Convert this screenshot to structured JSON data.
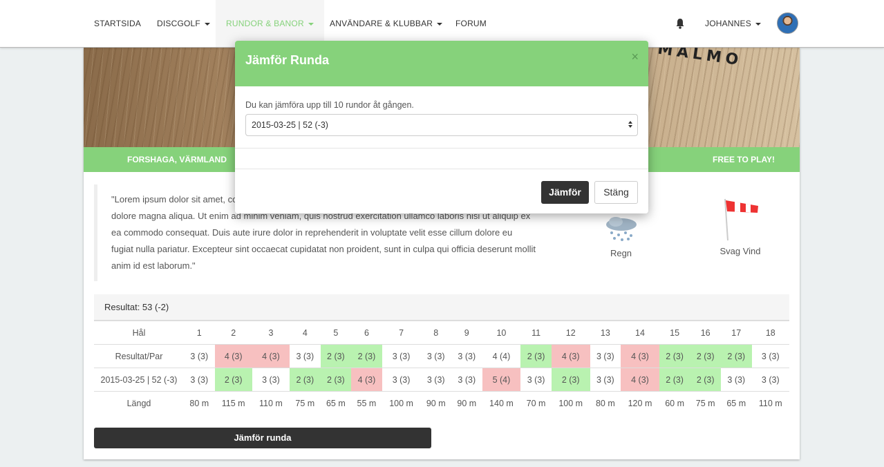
{
  "nav": {
    "items": [
      {
        "label": "STARTSIDA",
        "caret": false
      },
      {
        "label": "DISCGOLF",
        "caret": true
      },
      {
        "label": "RUNDOR & BANOR",
        "caret": true
      },
      {
        "label": "ANVÄNDARE & KLUBBAR",
        "caret": true
      },
      {
        "label": "FORUM",
        "caret": false
      }
    ],
    "user": "JOHANNES",
    "accent_color": "#86d27b"
  },
  "banner": {
    "text": "MALMO"
  },
  "info_bar": {
    "location": "FORSHAGA, VÄRMLAND",
    "price": "FREE TO PLAY!"
  },
  "description": "\"Lorem ipsum dolor sit amet, consectetur adipiscing elit, sed do eiusmod tempor incididunt ut labore et dolore magna aliqua. Ut enim ad minim veniam, quis nostrud exercitation ullamco laboris nisi ut aliquip ex ea commodo consequat. Duis aute irure dolor in reprehenderit in voluptate velit esse cillum dolore eu fugiat nulla pariatur. Excepteur sint occaecat cupidatat non proident, sunt in culpa qui officia deserunt mollit anim id est laborum.\"",
  "weather": {
    "rain": "Regn",
    "wind": "Svag Vind"
  },
  "result": {
    "summary": "Resultat: 53 (-2)",
    "header_label": "Hål",
    "holes": [
      "1",
      "2",
      "3",
      "4",
      "5",
      "6",
      "7",
      "8",
      "9",
      "10",
      "11",
      "12",
      "13",
      "14",
      "15",
      "16",
      "17",
      "18"
    ],
    "rows": [
      {
        "label": "Resultat/Par",
        "cells": [
          {
            "v": "3 (3)",
            "s": ""
          },
          {
            "v": "4 (3)",
            "s": "r"
          },
          {
            "v": "4 (3)",
            "s": "r"
          },
          {
            "v": "3 (3)",
            "s": ""
          },
          {
            "v": "2 (3)",
            "s": "g"
          },
          {
            "v": "2 (3)",
            "s": "g"
          },
          {
            "v": "3 (3)",
            "s": ""
          },
          {
            "v": "3 (3)",
            "s": ""
          },
          {
            "v": "3 (3)",
            "s": ""
          },
          {
            "v": "4 (4)",
            "s": ""
          },
          {
            "v": "2 (3)",
            "s": "g"
          },
          {
            "v": "4 (3)",
            "s": "r"
          },
          {
            "v": "3 (3)",
            "s": ""
          },
          {
            "v": "4 (3)",
            "s": "r"
          },
          {
            "v": "2 (3)",
            "s": "g"
          },
          {
            "v": "2 (3)",
            "s": "g"
          },
          {
            "v": "2 (3)",
            "s": "g"
          },
          {
            "v": "3 (3)",
            "s": ""
          }
        ]
      },
      {
        "label": "2015-03-25 | 52 (-3)",
        "cells": [
          {
            "v": "3 (3)",
            "s": ""
          },
          {
            "v": "2 (3)",
            "s": "g"
          },
          {
            "v": "3 (3)",
            "s": ""
          },
          {
            "v": "2 (3)",
            "s": "g"
          },
          {
            "v": "2 (3)",
            "s": "g"
          },
          {
            "v": "4 (3)",
            "s": "r"
          },
          {
            "v": "3 (3)",
            "s": ""
          },
          {
            "v": "3 (3)",
            "s": ""
          },
          {
            "v": "3 (3)",
            "s": ""
          },
          {
            "v": "5 (4)",
            "s": "r"
          },
          {
            "v": "3 (3)",
            "s": ""
          },
          {
            "v": "2 (3)",
            "s": "g"
          },
          {
            "v": "3 (3)",
            "s": ""
          },
          {
            "v": "4 (3)",
            "s": "r"
          },
          {
            "v": "2 (3)",
            "s": "g"
          },
          {
            "v": "2 (3)",
            "s": "g"
          },
          {
            "v": "3 (3)",
            "s": ""
          },
          {
            "v": "3 (3)",
            "s": ""
          }
        ]
      },
      {
        "label": "Längd",
        "cells": [
          {
            "v": "80 m",
            "s": ""
          },
          {
            "v": "115 m",
            "s": ""
          },
          {
            "v": "110 m",
            "s": ""
          },
          {
            "v": "75 m",
            "s": ""
          },
          {
            "v": "65 m",
            "s": ""
          },
          {
            "v": "55 m",
            "s": ""
          },
          {
            "v": "100 m",
            "s": ""
          },
          {
            "v": "90 m",
            "s": ""
          },
          {
            "v": "90 m",
            "s": ""
          },
          {
            "v": "140 m",
            "s": ""
          },
          {
            "v": "70 m",
            "s": ""
          },
          {
            "v": "100 m",
            "s": ""
          },
          {
            "v": "80 m",
            "s": ""
          },
          {
            "v": "120 m",
            "s": ""
          },
          {
            "v": "60 m",
            "s": ""
          },
          {
            "v": "75 m",
            "s": ""
          },
          {
            "v": "65 m",
            "s": ""
          },
          {
            "v": "110 m",
            "s": ""
          }
        ]
      }
    ],
    "compare_button": "Jämför runda"
  },
  "modal": {
    "title": "Jämför Runda",
    "close": "×",
    "hint": "Du kan jämföra upp till 10 rundor åt gången.",
    "selected": "2015-03-25 | 52 (-3)",
    "compare": "Jämför",
    "close_button": "Stäng"
  }
}
